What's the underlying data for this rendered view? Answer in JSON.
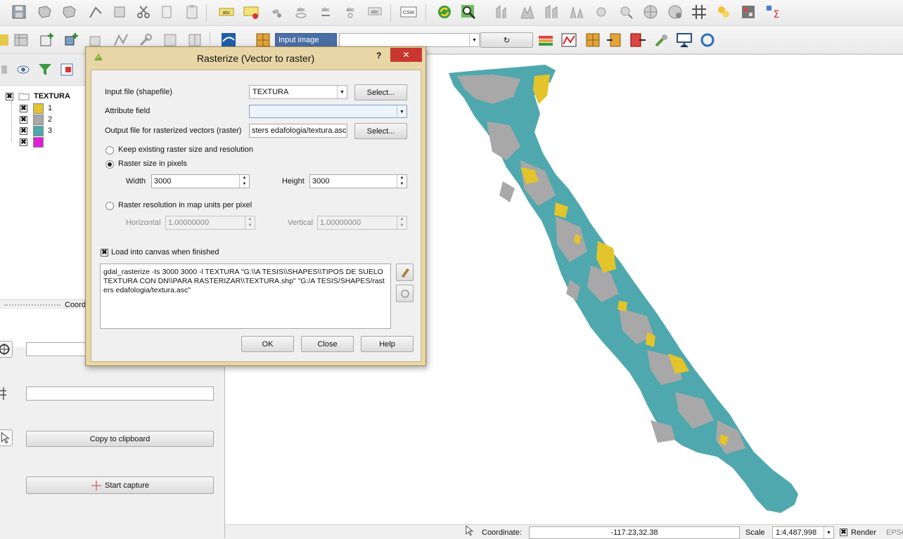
{
  "toolbar2": {
    "input_combo_label": "Input image",
    "rotate_glyph": "↻"
  },
  "layers": {
    "group_name": "TEXTURA",
    "items": [
      {
        "label": "1",
        "color": "#e3c42a"
      },
      {
        "label": "2",
        "color": "#a8a8a8"
      },
      {
        "label": "3",
        "color": "#4fa8ad"
      },
      {
        "label": "",
        "color": "#e21fd6"
      }
    ],
    "panel_tab": "Coordi"
  },
  "coord_panel": {
    "copy_label": "Copy to clipboard",
    "capture_label": "Start capture"
  },
  "dialog": {
    "title": "Rasterize (Vector to raster)",
    "help_glyph": "?",
    "close_glyph": "✕",
    "input_label": "Input file (shapefile)",
    "input_value": "TEXTURA",
    "attribute_label": "Attribute field",
    "attribute_value": "",
    "output_label": "Output file for rasterized vectors (raster)",
    "output_value": "sters edafologia/textura.asc",
    "select_label": "Select...",
    "keep_label": "Keep existing raster size and resolution",
    "size_label": "Raster size in pixels",
    "width_label": "Width",
    "width_value": "3000",
    "height_label": "Height",
    "height_value": "3000",
    "resolution_label": "Raster resolution in map units per pixel",
    "horizontal_label": "Horizontal",
    "horizontal_value": "1.00000000",
    "vertical_label": "Vertical",
    "vertical_value": "1.00000000",
    "load_label": "Load into canvas when finished",
    "command": "gdal_rasterize -ts 3000 3000 -l TEXTURA \"G:\\\\A TESIS\\\\SHAPES\\\\TIPOS DE SUELO TEXTURA CON DN\\\\PARA RASTERIZAR\\\\TEXTURA.shp\" \"G:/A TESIS/SHAPES/rasters edafologia/textura.asc\"",
    "ok_label": "OK",
    "close_label": "Close",
    "help_label": "Help"
  },
  "status": {
    "coordinate_label": "Coordinate:",
    "coordinate_value": "-117.23,32.38",
    "scale_label": "Scale",
    "scale_value": "1:4,487,998",
    "render_label": "Render",
    "epsg_label": "EPSG"
  },
  "colors": {
    "class1": "#e3c42a",
    "class2": "#a8a8a8",
    "class3": "#4fa8ad",
    "class4": "#e21fd6"
  }
}
